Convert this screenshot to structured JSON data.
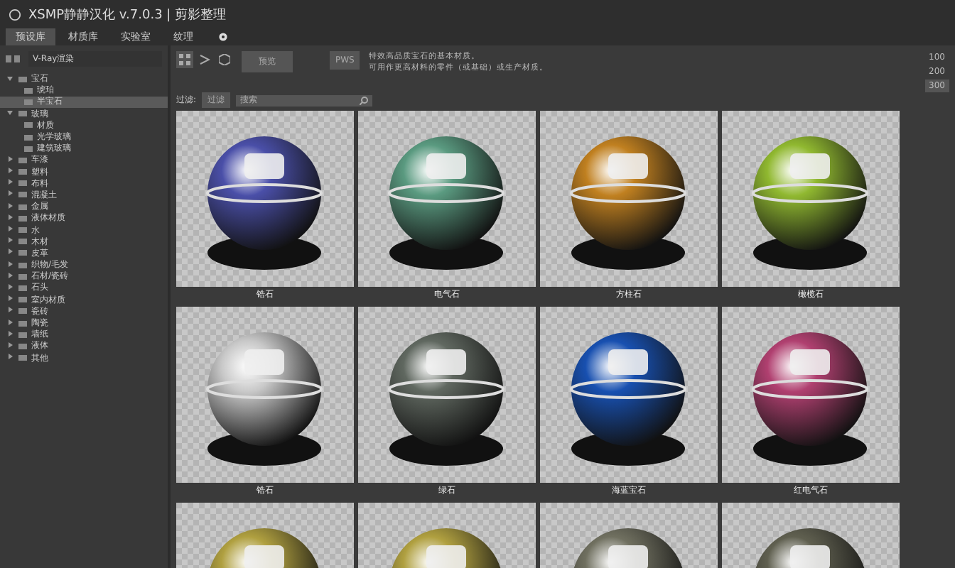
{
  "window": {
    "title": "XSMP静静汉化 v.7.0.3 | 剪影整理"
  },
  "tabs": [
    {
      "label": "预设库",
      "selected": true
    },
    {
      "label": "材质库",
      "selected": false
    },
    {
      "label": "实验室",
      "selected": false
    },
    {
      "label": "纹理",
      "selected": false
    }
  ],
  "sidebar": {
    "renderer": "V-Ray渲染",
    "tree": [
      {
        "label": "宝石",
        "expanded": true,
        "selected": false,
        "children": [
          {
            "label": "琥珀",
            "selected": false
          },
          {
            "label": "半宝石",
            "selected": true
          }
        ]
      },
      {
        "label": "玻璃",
        "expanded": true,
        "selected": false,
        "children": [
          {
            "label": "材质",
            "selected": false
          },
          {
            "label": "光学玻璃",
            "selected": false
          },
          {
            "label": "建筑玻璃",
            "selected": false
          }
        ]
      },
      {
        "label": "车漆",
        "expanded": false,
        "selected": false
      },
      {
        "label": "塑料",
        "expanded": false,
        "selected": false
      },
      {
        "label": "布料",
        "expanded": false,
        "selected": false
      },
      {
        "label": "混凝土",
        "expanded": false,
        "selected": false
      },
      {
        "label": "金属",
        "expanded": false,
        "selected": false
      },
      {
        "label": "液体材质",
        "expanded": false,
        "selected": false
      },
      {
        "label": "水",
        "expanded": false,
        "selected": false
      },
      {
        "label": "木材",
        "expanded": false,
        "selected": false
      },
      {
        "label": "皮革",
        "expanded": false,
        "selected": false
      },
      {
        "label": "织物/毛发",
        "expanded": false,
        "selected": false
      },
      {
        "label": "石材/瓷砖",
        "expanded": false,
        "selected": false
      },
      {
        "label": "石头",
        "expanded": false,
        "selected": false
      },
      {
        "label": "室内材质",
        "expanded": false,
        "selected": false
      },
      {
        "label": "瓷砖",
        "expanded": false,
        "selected": false
      },
      {
        "label": "陶瓷",
        "expanded": false,
        "selected": false
      },
      {
        "label": "墙纸",
        "expanded": false,
        "selected": false
      },
      {
        "label": "液体",
        "expanded": false,
        "selected": false
      },
      {
        "label": "其他",
        "expanded": false,
        "selected": false
      }
    ]
  },
  "toolbar": {
    "preview_button": "预览",
    "pws_button": "PWS",
    "description": [
      "特效高品质宝石的基本材质。",
      "可用作更高材料的零件（或基础）或生产材质。"
    ]
  },
  "sizes": [
    {
      "label": "100",
      "selected": false
    },
    {
      "label": "200",
      "selected": false
    },
    {
      "label": "300",
      "selected": true
    }
  ],
  "filter": {
    "label": "过滤:",
    "button": "过滤",
    "placeholder": "搜索"
  },
  "materials": [
    {
      "label": "锆石",
      "color": "#4a4fa8"
    },
    {
      "label": "电气石",
      "color": "#5a9a80"
    },
    {
      "label": "方柱石",
      "color": "#c08020"
    },
    {
      "label": "橄榄石",
      "color": "#90b830"
    },
    {
      "label": "锆石",
      "color": "#c8c8c8"
    },
    {
      "label": "绿石",
      "color": "#606860"
    },
    {
      "label": "海蓝宝石",
      "color": "#1850b0"
    },
    {
      "label": "红电气石",
      "color": "#b04070"
    },
    {
      "color": "#b0a040"
    },
    {
      "color": "#b0a040"
    },
    {
      "color": "#707060"
    },
    {
      "color": "#606050"
    }
  ]
}
